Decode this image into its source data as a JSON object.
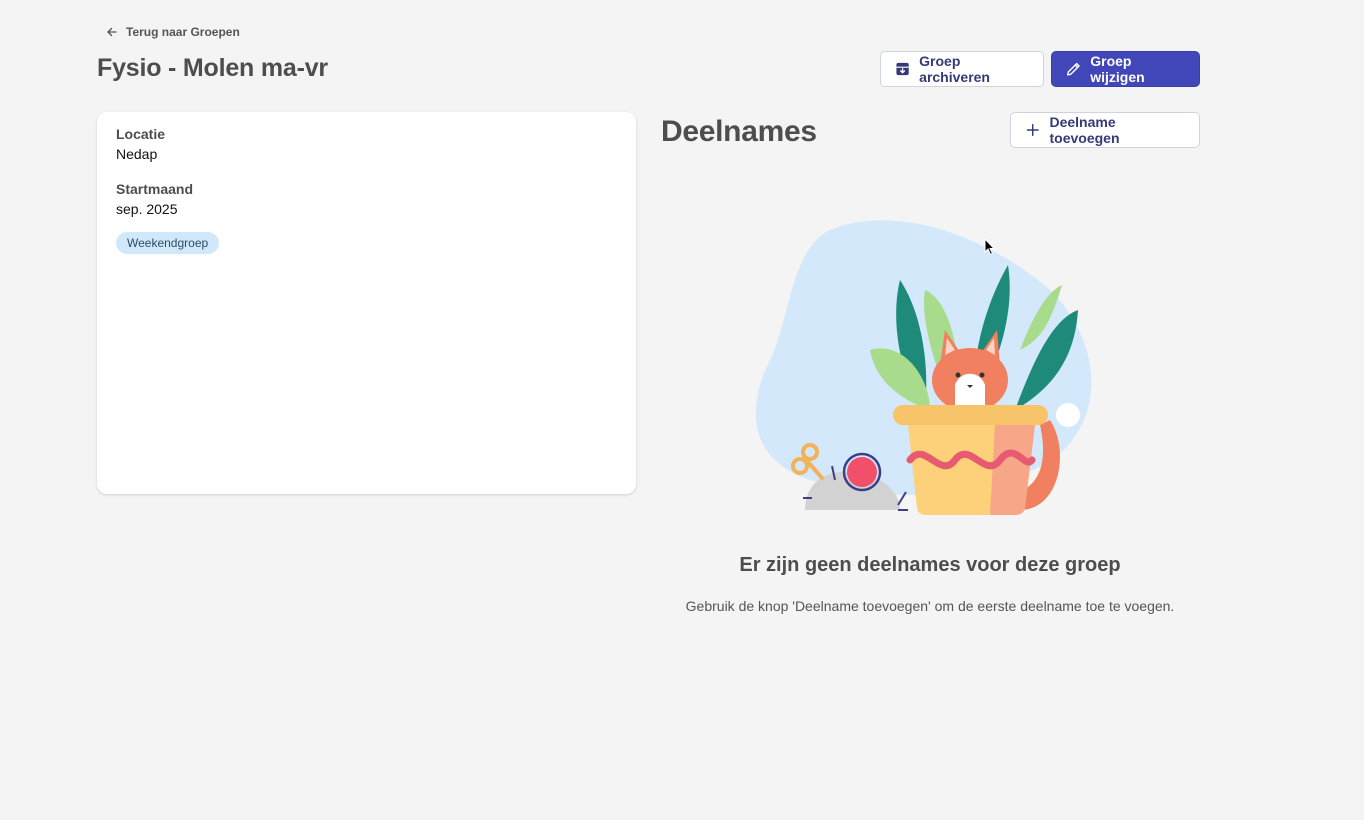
{
  "nav": {
    "back_label": "Terug naar Groepen"
  },
  "page": {
    "title": "Fysio - Molen ma-vr"
  },
  "actions": {
    "archive_label": "Groep archiveren",
    "edit_label": "Groep wijzigen",
    "add_participation_label": "Deelname toevoegen"
  },
  "details": {
    "location_label": "Locatie",
    "location_value": "Nedap",
    "start_label": "Startmaand",
    "start_value": "sep. 2025",
    "tag": "Weekendgroep"
  },
  "participations": {
    "title": "Deelnames",
    "empty_title": "Er zijn geen deelnames voor deze groep",
    "empty_desc": "Gebruik de knop 'Deelname toevoegen' om de eerste deelname toe te voegen."
  },
  "icons": {
    "back": "arrow-left-icon",
    "archive": "archive-box-icon",
    "edit": "pencil-icon",
    "add": "plus-icon"
  },
  "colors": {
    "primary": "#4146b8",
    "badge_bg": "#cfe8fa",
    "background": "#f4f4f4"
  }
}
